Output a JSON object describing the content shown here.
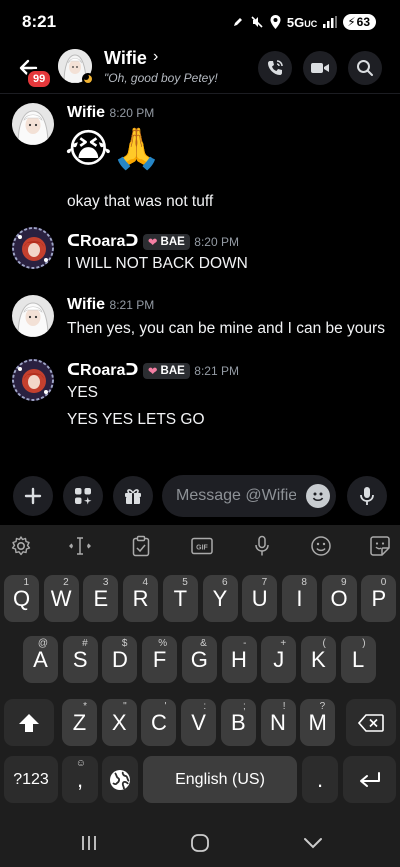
{
  "status_bar": {
    "time": "8:21",
    "network": "5G",
    "network_sub": "UC",
    "battery": "63"
  },
  "header": {
    "name": "Wifie",
    "status": "\"Oh, good boy Petey!",
    "unread_badge": "99"
  },
  "messages": [
    {
      "author": "Wifie",
      "time": "8:20 PM",
      "emoji": "😭🙏",
      "text": "okay that was not tuff",
      "avatar": "wifie"
    },
    {
      "author": "ᑕRoaraᑐ",
      "tag": "BAE",
      "time": "8:20 PM",
      "text": "I WILL NOT BACK DOWN",
      "avatar": "roara"
    },
    {
      "author": "Wifie",
      "time": "8:21 PM",
      "text": "Then yes, you can be mine and I can be yours",
      "avatar": "wifie"
    },
    {
      "author": "ᑕRoaraᑐ",
      "tag": "BAE",
      "time": "8:21 PM",
      "text": "YES",
      "text2": "YES YES LETS GO",
      "avatar": "roara"
    }
  ],
  "composer": {
    "placeholder": "Message @Wifie"
  },
  "keyboard": {
    "row1": [
      {
        "k": "Q",
        "h": "1"
      },
      {
        "k": "W",
        "h": "2"
      },
      {
        "k": "E",
        "h": "3"
      },
      {
        "k": "R",
        "h": "4"
      },
      {
        "k": "T",
        "h": "5"
      },
      {
        "k": "Y",
        "h": "6"
      },
      {
        "k": "U",
        "h": "7"
      },
      {
        "k": "I",
        "h": "8"
      },
      {
        "k": "O",
        "h": "9"
      },
      {
        "k": "P",
        "h": "0"
      }
    ],
    "row2": [
      {
        "k": "A",
        "h": "@"
      },
      {
        "k": "S",
        "h": "#"
      },
      {
        "k": "D",
        "h": "$"
      },
      {
        "k": "F",
        "h": "%"
      },
      {
        "k": "G",
        "h": "&"
      },
      {
        "k": "H",
        "h": "-"
      },
      {
        "k": "J",
        "h": "+"
      },
      {
        "k": "K",
        "h": "("
      },
      {
        "k": "L",
        "h": ")"
      }
    ],
    "row3": [
      {
        "k": "Z",
        "h": "*"
      },
      {
        "k": "X",
        "h": "\""
      },
      {
        "k": "C",
        "h": "'"
      },
      {
        "k": "V",
        "h": ":"
      },
      {
        "k": "B",
        "h": ";"
      },
      {
        "k": "N",
        "h": "!"
      },
      {
        "k": "M",
        "h": "?"
      }
    ],
    "symbols_key": "?123",
    "comma_key": ",",
    "comma_hint": "☺",
    "space_label": "English (US)",
    "period_key": "."
  },
  "colors": {
    "background": "#000000",
    "surface": "#1e1f24",
    "keyboard": "#1e1e1e",
    "key": "#3d3d3d",
    "badge": "#e5383b",
    "idle_moon": "#f0b232"
  }
}
